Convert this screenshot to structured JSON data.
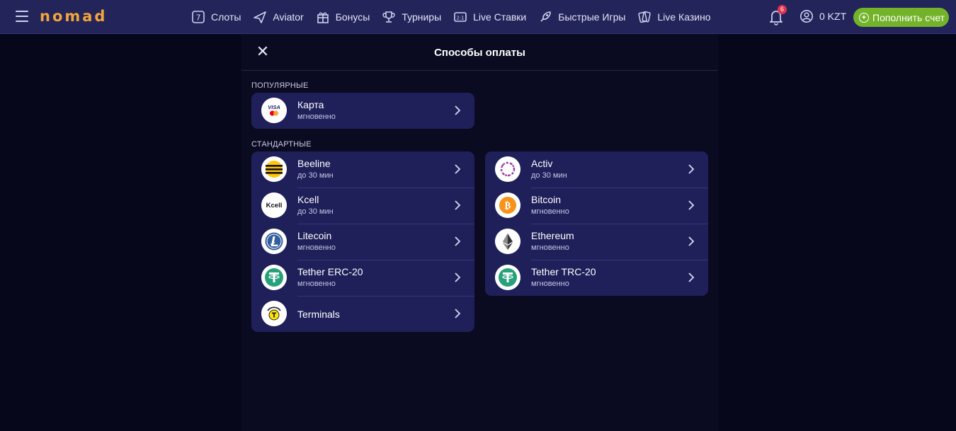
{
  "header": {
    "logo": "nomad",
    "nav": [
      {
        "icon": "slots-icon",
        "label": "Слоты"
      },
      {
        "icon": "plane-icon",
        "label": "Aviator"
      },
      {
        "icon": "gift-icon",
        "label": "Бонусы"
      },
      {
        "icon": "trophy-icon",
        "label": "Турниры"
      },
      {
        "icon": "scoreboard-icon",
        "label": "Live Ставки"
      },
      {
        "icon": "rocket-icon",
        "label": "Быстрые Игры"
      },
      {
        "icon": "cards-icon",
        "label": "Live Казино"
      }
    ],
    "notifications_count": "6",
    "balance": "0 KZT",
    "deposit_label": "Пополнить счет",
    "accent_color": "#73b32a"
  },
  "modal": {
    "title": "Способы оплаты",
    "popular_title": "ПОПУЛЯРНЫЕ",
    "standard_title": "СТАНДАРТНЫЕ",
    "popular": [
      {
        "name": "Карта",
        "time": "мгновенно",
        "icon": "visa-mastercard-icon"
      }
    ],
    "standard_left": [
      {
        "name": "Beeline",
        "time": "до 30 мин",
        "icon": "beeline-icon"
      },
      {
        "name": "Kcell",
        "time": "до 30 мин",
        "icon": "kcell-icon"
      },
      {
        "name": "Litecoin",
        "time": "мгновенно",
        "icon": "litecoin-icon"
      },
      {
        "name": "Tether ERC-20",
        "time": "мгновенно",
        "icon": "tether-icon"
      },
      {
        "name": "Terminals",
        "time": "",
        "icon": "terminal-icon"
      }
    ],
    "standard_right": [
      {
        "name": "Activ",
        "time": "до 30 мин",
        "icon": "activ-icon"
      },
      {
        "name": "Bitcoin",
        "time": "мгновенно",
        "icon": "bitcoin-icon"
      },
      {
        "name": "Ethereum",
        "time": "мгновенно",
        "icon": "ethereum-icon"
      },
      {
        "name": "Tether TRC-20",
        "time": "мгновенно",
        "icon": "tether-icon"
      }
    ]
  }
}
